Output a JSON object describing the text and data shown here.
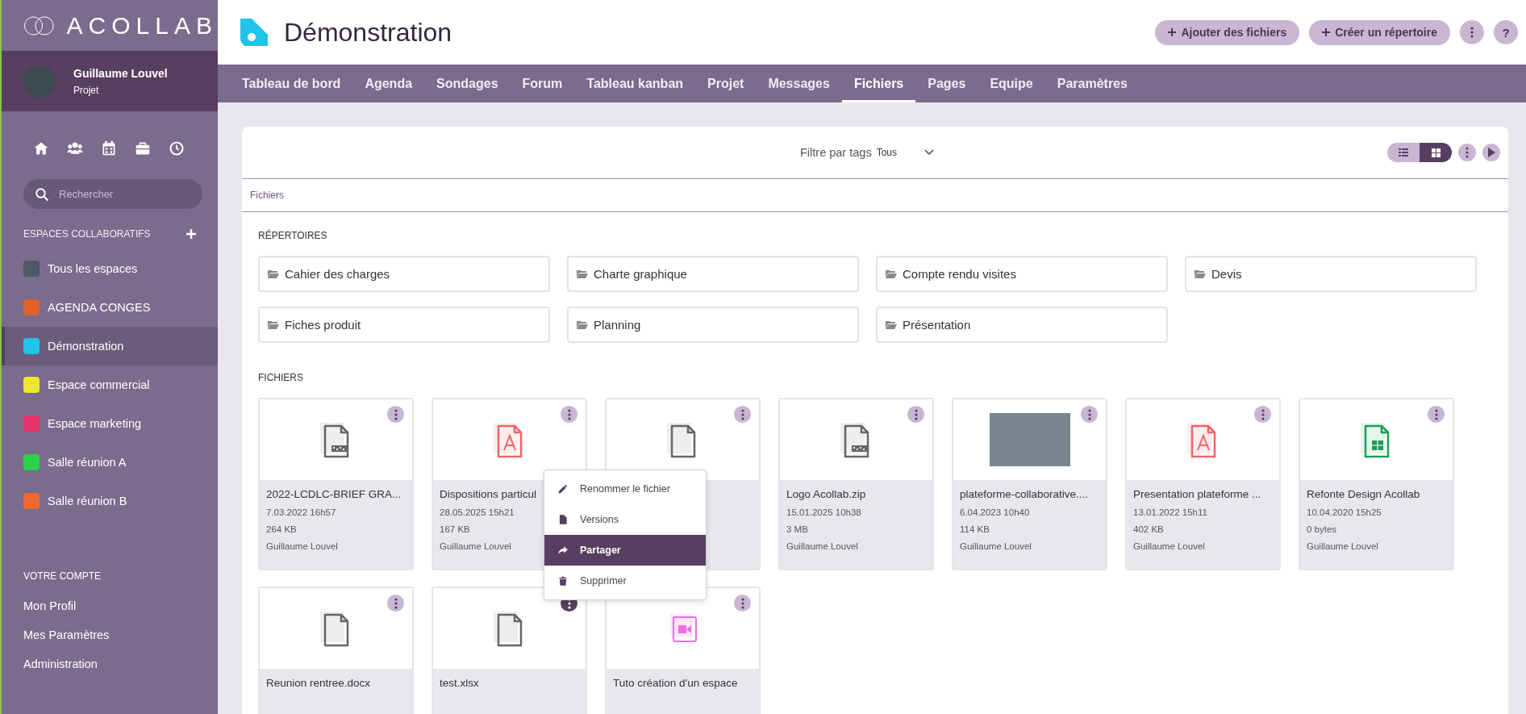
{
  "sidebar": {
    "logo": "ACOLLAB",
    "user": {
      "name": "Guillaume Louvel",
      "role": "Projet"
    },
    "shortcuts": [
      {
        "kind": "home"
      },
      {
        "kind": "users"
      },
      {
        "kind": "calendar"
      },
      {
        "kind": "briefcase"
      },
      {
        "kind": "clock"
      }
    ],
    "search": {
      "placeholder": "Rechercher"
    },
    "spaces_heading": "ESPACES COLLABORATIFS",
    "spaces": [
      {
        "label": "Tous les espaces",
        "color": "#4b5a66",
        "selected": false
      },
      {
        "label": "AGENDA CONGES",
        "color": "#e0622c",
        "selected": false
      },
      {
        "label": "Démonstration",
        "color": "#22c3ea",
        "selected": true
      },
      {
        "label": "Espace commercial",
        "color": "#efe631",
        "selected": false
      },
      {
        "label": "Espace marketing",
        "color": "#e8336b",
        "selected": false
      },
      {
        "label": "Salle réunion A",
        "color": "#2bd04b",
        "selected": false
      },
      {
        "label": "Salle réunion B",
        "color": "#f0692f",
        "selected": false
      }
    ],
    "account_heading": "VOTRE COMPTE",
    "account": [
      "Mon Profil",
      "Mes Paramètres",
      "Administration"
    ]
  },
  "header": {
    "title": "Démonstration",
    "buttons": [
      "Ajouter des fichiers",
      "Créer un répertoire"
    ],
    "help": "?"
  },
  "tabs": [
    {
      "label": "Tableau de bord",
      "selected": false
    },
    {
      "label": "Agenda",
      "selected": false
    },
    {
      "label": "Sondages",
      "selected": false
    },
    {
      "label": "Forum",
      "selected": false
    },
    {
      "label": "Tableau kanban",
      "selected": false
    },
    {
      "label": "Projet",
      "selected": false
    },
    {
      "label": "Messages",
      "selected": false
    },
    {
      "label": "Fichiers",
      "selected": true
    },
    {
      "label": "Pages",
      "selected": false
    },
    {
      "label": "Equipe",
      "selected": false
    },
    {
      "label": "Paramètres",
      "selected": false
    }
  ],
  "filter": {
    "label": "Filtre par tags",
    "value": "Tous"
  },
  "views": [
    {
      "kind": "list",
      "selected": false
    },
    {
      "kind": "grid",
      "selected": true
    }
  ],
  "breadcrumb": "Fichiers",
  "folders_heading": "RÉPERTOIRES",
  "folders": [
    "Cahier des charges",
    "Charte graphique",
    "Compte rendu visites",
    "Devis",
    "Fiches produit",
    "Planning",
    "Présentation"
  ],
  "files_heading": "FICHIERS",
  "files": [
    {
      "kind": "archive",
      "name": "2022-LCDLC-BRIEF GRA...",
      "date": "7.03.2022 16h57",
      "size": "264 KB",
      "owner": "Guillaume Louvel",
      "menu_open": false
    },
    {
      "kind": "pdf",
      "name": "Dispositions particul",
      "date": "28.05.2025 15h21",
      "size": "167 KB",
      "owner": "Guillaume Louvel",
      "menu_open": false
    },
    {
      "kind": "generic",
      "menu_open": false
    },
    {
      "kind": "archive",
      "name": "Logo Acollab.zip",
      "date": "15.01.2025 10h38",
      "size": "3 MB",
      "owner": "Guillaume Louvel",
      "menu_open": false
    },
    {
      "kind": "photo",
      "name": "plateforme-collaborative....",
      "date": "6.04.2023 10h40",
      "size": "114 KB",
      "owner": "Guillaume Louvel",
      "menu_open": false
    },
    {
      "kind": "pdf",
      "name": "Presentation plateforme ...",
      "date": "13.01.2022 15h11",
      "size": "402 KB",
      "owner": "Guillaume Louvel",
      "menu_open": false
    },
    {
      "kind": "spreadsheet",
      "name": "Refonte Design Acollab",
      "date": "10.04.2020 15h25",
      "size": "0 bytes",
      "owner": "Guillaume Louvel",
      "menu_open": false
    },
    {
      "kind": "generic",
      "name": "Reunion rentree.docx",
      "menu_open": false
    },
    {
      "kind": "generic",
      "name": "test.xlsx",
      "menu_open": true
    },
    {
      "kind": "video",
      "name": "Tuto création d'un espace",
      "menu_open": false
    }
  ],
  "context_menu": {
    "items": [
      {
        "kind": "pencil",
        "label": "Renommer le fichier",
        "selected": false
      },
      {
        "kind": "file",
        "label": "Versions",
        "selected": false
      },
      {
        "kind": "share",
        "label": "Partager",
        "selected": true
      },
      {
        "kind": "trash",
        "label": "Supprimer",
        "selected": false
      }
    ]
  }
}
